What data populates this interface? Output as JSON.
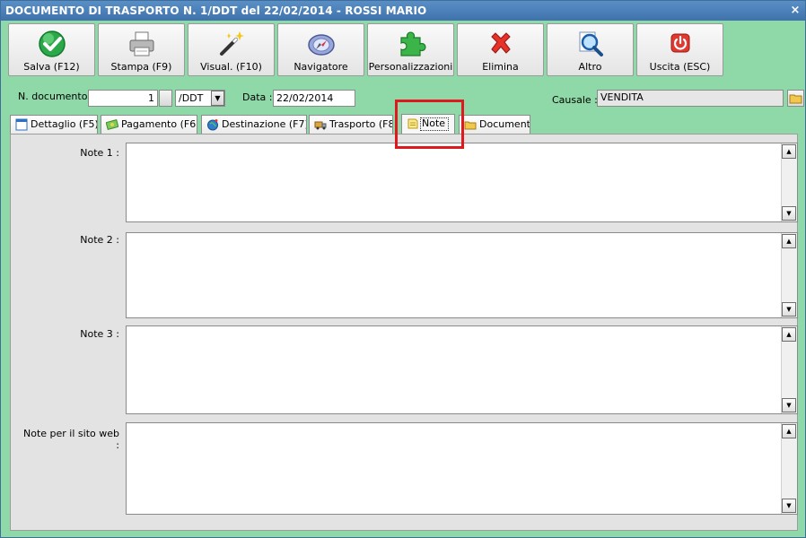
{
  "window": {
    "title": "DOCUMENTO DI TRASPORTO N. 1/DDT del 22/02/2014 - ROSSI MARIO",
    "close_glyph": "×"
  },
  "toolbar": [
    {
      "label": "Salva (F12)",
      "icon": "save-check-icon"
    },
    {
      "label": "Stampa (F9)",
      "icon": "printer-icon"
    },
    {
      "label": "Visual. (F10)",
      "icon": "magic-wand-icon"
    },
    {
      "label": "Navigatore",
      "icon": "compass-icon"
    },
    {
      "label": "Personalizzazioni",
      "icon": "puzzle-icon"
    },
    {
      "label": "Elimina",
      "icon": "delete-x-icon"
    },
    {
      "label": "Altro",
      "icon": "magnifier-icon"
    },
    {
      "label": "Uscita (ESC)",
      "icon": "power-icon"
    }
  ],
  "header": {
    "doc_number_label": "N. documento :",
    "doc_number_value": "1",
    "series_value": "/DDT",
    "date_label": "Data :",
    "date_value": "22/02/2014",
    "causale_label": "Causale :",
    "causale_value": "VENDITA"
  },
  "tabs": [
    {
      "label": "Dettaglio (F5)",
      "icon": "window-icon"
    },
    {
      "label": "Pagamento (F6)",
      "icon": "money-icon"
    },
    {
      "label": "Destinazione (F7)",
      "icon": "globe-icon"
    },
    {
      "label": "Trasporto (F8)",
      "icon": "truck-icon"
    },
    {
      "label": "Note",
      "icon": "note-icon",
      "active": true
    },
    {
      "label": "Documenti",
      "icon": "folder-icon"
    }
  ],
  "notes": {
    "note1_label": "Note 1 :",
    "note2_label": "Note 2 :",
    "note3_label": "Note 3 :",
    "web_label": "Note per il sito web :",
    "note1_value": "",
    "note2_value": "",
    "note3_value": "",
    "web_value": ""
  },
  "colors": {
    "window_bg": "#8fd8a8",
    "title_bg": "#4a7fb8",
    "highlight": "#e0191f"
  }
}
